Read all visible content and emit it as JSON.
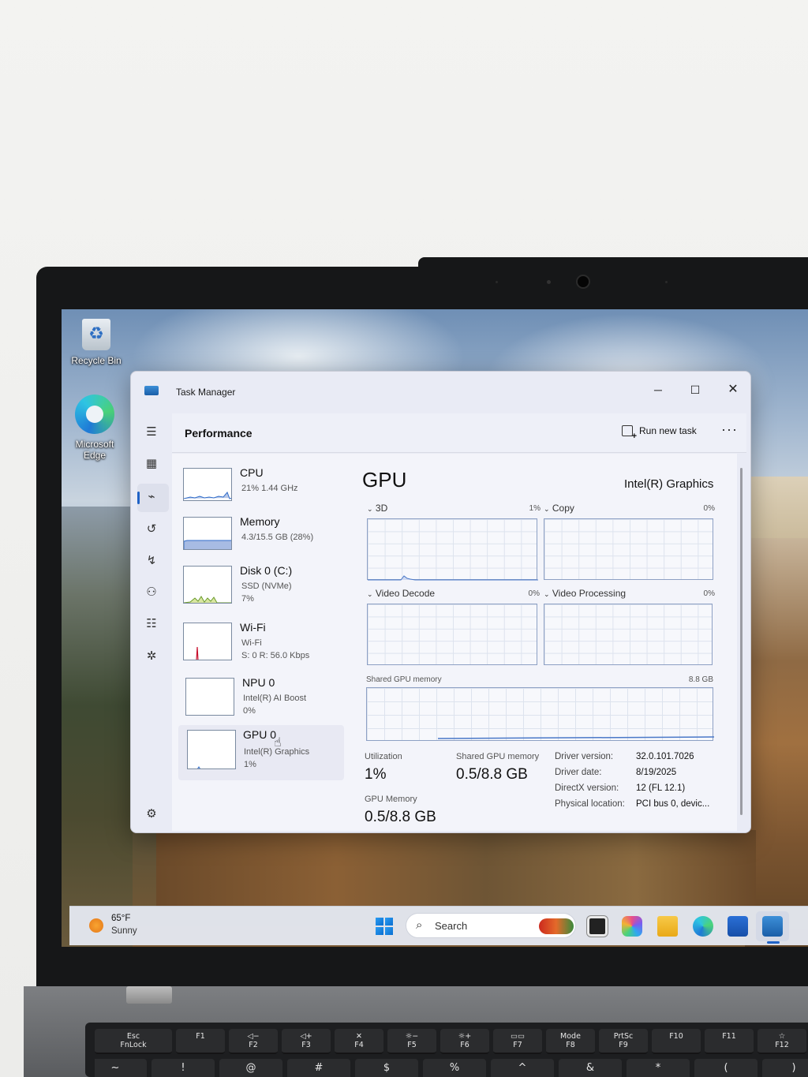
{
  "desktop": {
    "recycle_bin_label": "Recycle Bin",
    "edge_label": "Microsoft Edge"
  },
  "window": {
    "title": "Task Manager",
    "minimize": "─",
    "maximize": "☐",
    "close": "✕"
  },
  "header": {
    "title": "Performance",
    "run_new_task": "Run new task",
    "more": "···"
  },
  "resources": [
    {
      "name": "CPU",
      "line1": "21%  1.44 GHz",
      "line2": "",
      "line3": ""
    },
    {
      "name": "Memory",
      "line1": "4.3/15.5 GB (28%)",
      "line2": "",
      "line3": ""
    },
    {
      "name": "Disk 0 (C:)",
      "line1": "SSD (NVMe)",
      "line2": "7%",
      "line3": ""
    },
    {
      "name": "Wi-Fi",
      "line1": "Wi-Fi",
      "line2": "S: 0  R: 56.0 Kbps",
      "line3": ""
    },
    {
      "name": "NPU 0",
      "line1": "Intel(R) AI Boost",
      "line2": "0%",
      "line3": ""
    },
    {
      "name": "GPU 0",
      "line1": "Intel(R) Graphics",
      "line2": "1%",
      "line3": ""
    }
  ],
  "gpu": {
    "heading": "GPU",
    "model": "Intel(R) Graphics",
    "engines": [
      {
        "label": "3D",
        "pct": "1%"
      },
      {
        "label": "Copy",
        "pct": "0%"
      },
      {
        "label": "Video Decode",
        "pct": "0%"
      },
      {
        "label": "Video Processing",
        "pct": "0%"
      }
    ],
    "shared_mem_graph_label": "Shared GPU memory",
    "shared_mem_graph_max": "8.8 GB",
    "stats": {
      "utilization_label": "Utilization",
      "utilization_value": "1%",
      "shared_label": "Shared GPU memory",
      "shared_value": "0.5/8.8 GB",
      "gpu_mem_label": "GPU Memory",
      "gpu_mem_value": "0.5/8.8 GB"
    },
    "properties": [
      {
        "key": "Driver version:",
        "value": "32.0.101.7026"
      },
      {
        "key": "Driver date:",
        "value": "8/19/2025"
      },
      {
        "key": "DirectX version:",
        "value": "12 (FL 12.1)"
      },
      {
        "key": "Physical location:",
        "value": "PCI bus 0, devic..."
      }
    ]
  },
  "taskbar": {
    "temperature": "65°F",
    "condition": "Sunny",
    "search_label": "Search"
  },
  "keyboard": {
    "row1": [
      "Esc\nFnLock",
      "\nF1",
      "◁−\nF2",
      "◁+\nF3",
      "✕\nF4",
      "☼−\nF5",
      "☼+\nF6",
      "▭▭\nF7",
      "Mode\nF8",
      "PrtSc\nF9",
      "\nF10",
      "\nF11",
      "☆\nF12"
    ],
    "row2": [
      "~",
      "!",
      "@",
      "#",
      "$",
      "%",
      "^",
      "&",
      "*",
      "(",
      ")"
    ]
  }
}
